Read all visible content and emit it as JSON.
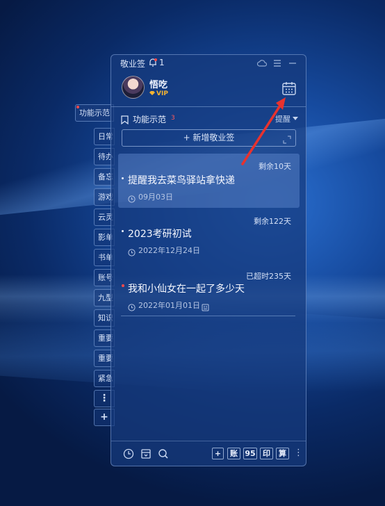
{
  "app": {
    "name": "敬业签",
    "notification_count": "1"
  },
  "user": {
    "name": "悟吃",
    "badge": "VIP"
  },
  "category": {
    "name": "功能示范",
    "count": "3",
    "sort_label": "提醒"
  },
  "add_button_label": "+ 新增敬业签",
  "side_tabs": [
    {
      "label": "功能示范"
    },
    {
      "label": "日常"
    },
    {
      "label": "待办"
    },
    {
      "label": "备忘"
    },
    {
      "label": "游戏"
    },
    {
      "label": "云灵"
    },
    {
      "label": "影单"
    },
    {
      "label": "书单"
    },
    {
      "label": "账号"
    },
    {
      "label": "九型"
    },
    {
      "label": "知识"
    },
    {
      "label": "重要"
    },
    {
      "label": "重要"
    },
    {
      "label": "紧急"
    },
    {
      "label": "⋮"
    },
    {
      "label": "+"
    }
  ],
  "notes": [
    {
      "remain": "剩余10天",
      "title": "提醒我去菜鸟驿站拿快递",
      "date": "09月03日"
    },
    {
      "remain": "剩余122天",
      "title": "2023考研初试",
      "date": "2022年12月24日"
    },
    {
      "remain": "已超时235天",
      "title": "我和小仙女在一起了多少天",
      "date": "2022年01月01日"
    }
  ],
  "footer_buttons": {
    "add": "+",
    "account": "账",
    "number": "95",
    "print": "印",
    "calc": "算"
  },
  "colors": {
    "accent_red": "#ff4a4a",
    "vip_gold": "#f5b431",
    "arrow_red": "#e8322e"
  }
}
